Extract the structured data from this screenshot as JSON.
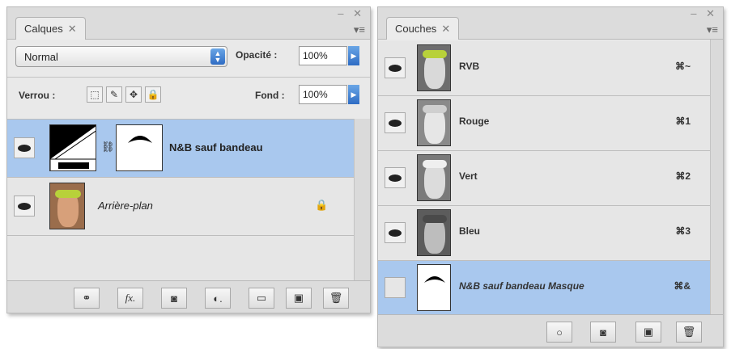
{
  "calques": {
    "tab_label": "Calques",
    "tab_close": "✕",
    "win_controls": "– ✕",
    "menu_icon": "▾≡",
    "blend_mode": "Normal",
    "opacity_label": "Opacité :",
    "opacity_value": "100%",
    "lock_label": "Verrou :",
    "fill_label": "Fond :",
    "fill_value": "100%",
    "layers": [
      {
        "name": "N&B sauf bandeau",
        "selected": true
      },
      {
        "name": "Arrière-plan",
        "selected": false
      }
    ],
    "bottom_buttons": {
      "link": "⚭",
      "fx": "fx.",
      "mask": "◙",
      "adjust": "◐.",
      "group": "▭",
      "new": "▣",
      "delete": "🗑"
    }
  },
  "couches": {
    "tab_label": "Couches",
    "tab_close": "✕",
    "win_controls": "– ✕",
    "menu_icon": "▾≡",
    "channels": [
      {
        "name": "RVB",
        "shortcut": "⌘~",
        "selected": false
      },
      {
        "name": "Rouge",
        "shortcut": "⌘1",
        "selected": false
      },
      {
        "name": "Vert",
        "shortcut": "⌘2",
        "selected": false
      },
      {
        "name": "Bleu",
        "shortcut": "⌘3",
        "selected": false
      },
      {
        "name": "N&B sauf bandeau Masque",
        "shortcut": "⌘&",
        "selected": true
      }
    ]
  },
  "colors": {
    "selection": "#a9c8ee",
    "panel_bg": "#e9e9e9",
    "accent_blue": "#2e6cc4",
    "headband_green": "#b8d13a"
  }
}
